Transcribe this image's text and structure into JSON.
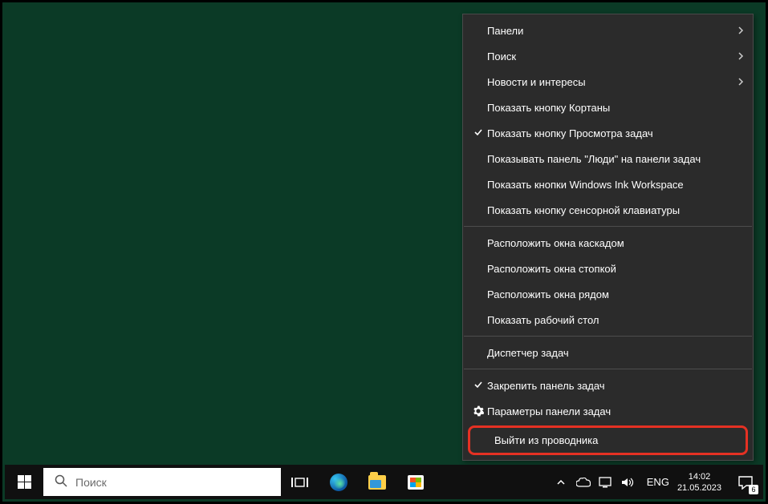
{
  "context_menu": {
    "items": [
      {
        "label": "Панели",
        "arrow": true
      },
      {
        "label": "Поиск",
        "arrow": true
      },
      {
        "label": "Новости и интересы",
        "arrow": true
      },
      {
        "label": "Показать кнопку Кортаны"
      },
      {
        "label": "Показать кнопку Просмотра задач",
        "checked": true
      },
      {
        "label": "Показывать панель \"Люди\" на панели задач"
      },
      {
        "label": "Показать кнопки Windows Ink Workspace"
      },
      {
        "label": "Показать кнопку сенсорной клавиатуры"
      },
      {
        "sep": true
      },
      {
        "label": "Расположить окна каскадом"
      },
      {
        "label": "Расположить окна стопкой"
      },
      {
        "label": "Расположить окна рядом"
      },
      {
        "label": "Показать рабочий стол"
      },
      {
        "sep": true
      },
      {
        "label": "Диспетчер задач"
      },
      {
        "sep": true
      },
      {
        "label": "Закрепить панель задач",
        "checked": true
      },
      {
        "label": "Параметры панели задач",
        "icon": "gear"
      },
      {
        "label": "Выйти из проводника",
        "highlight": true
      }
    ]
  },
  "taskbar": {
    "search_placeholder": "Поиск",
    "lang": "ENG",
    "time": "14:02",
    "date": "21.05.2023",
    "notif_count": "6",
    "tooltip_time_full": "14:02"
  }
}
